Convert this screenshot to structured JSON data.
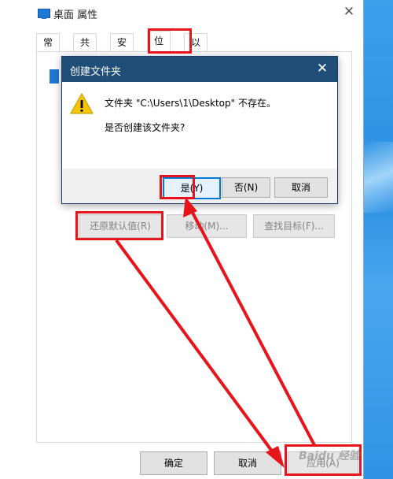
{
  "window": {
    "title": "桌面 属性",
    "close_glyph": "✕"
  },
  "tabs": [
    {
      "label": "常规"
    },
    {
      "label": "共享"
    },
    {
      "label": "安全"
    },
    {
      "label": "位置",
      "active": true
    },
    {
      "label": "以前的版本"
    }
  ],
  "location_buttons": {
    "restore": "还原默认值(R)",
    "move": "移动(M)...",
    "find_target": "查找目标(F)..."
  },
  "footer_buttons": {
    "ok": "确定",
    "cancel": "取消",
    "apply": "应用(A)"
  },
  "dialog": {
    "title": "创建文件夹",
    "close_glyph": "✕",
    "message": "文件夹 \"C:\\Users\\1\\Desktop\" 不存在。",
    "question": "是否创建该文件夹?",
    "yes": "是(Y)",
    "no": "否(N)",
    "cancel": "取消",
    "icon": "warning-icon"
  },
  "watermark": "Baidu 经验",
  "colors": {
    "annotation_red": "#e8141b",
    "dialog_title_bg": "#1f4e79",
    "window_icon": "#1e78d6"
  }
}
